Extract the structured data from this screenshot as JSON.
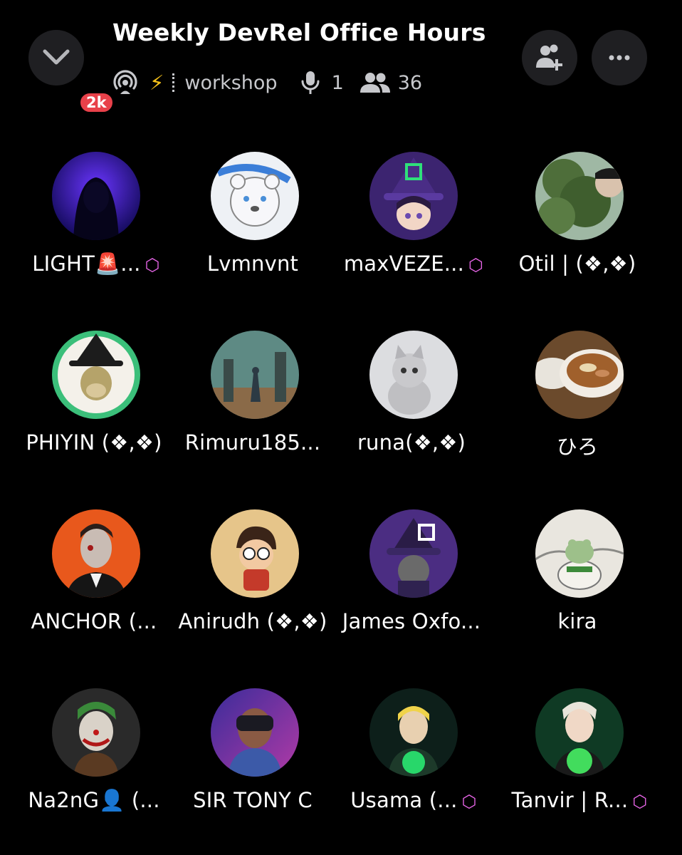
{
  "header": {
    "title": "Weekly DevRel Office Hours",
    "badge": "2k",
    "stage_icon": "stage-channel-icon",
    "emoji": "⚡",
    "channel": "workshop",
    "speakers_count": "1",
    "listeners_count": "36"
  },
  "icons": {
    "back": "chevron-down-icon",
    "invite": "add-user-icon",
    "more": "more-horizontal-icon",
    "mic": "microphone-icon",
    "group": "people-icon"
  },
  "participants": [
    {
      "name": "LIGHT🚨...",
      "boost": "⬡",
      "avatar": "hooded-figure-avatar"
    },
    {
      "name": "Lvmnvnt",
      "boost": "",
      "avatar": "bear-avatar"
    },
    {
      "name": "maxVEZE...",
      "boost": "⬡",
      "avatar": "witch-girl-avatar"
    },
    {
      "name": "Otil | (❖,❖)",
      "boost": "",
      "avatar": "tree-selfie-avatar"
    },
    {
      "name": "PHIYIN (❖,❖)",
      "boost": "",
      "avatar": "ape-wizard-avatar"
    },
    {
      "name": "Rimuru185...",
      "boost": "",
      "avatar": "ruins-avatar"
    },
    {
      "name": "runa(❖,❖)",
      "boost": "",
      "avatar": "kitten-avatar"
    },
    {
      "name": "ひろ",
      "boost": "",
      "avatar": "ramen-avatar"
    },
    {
      "name": "ANCHOR (...",
      "boost": "",
      "avatar": "man-in-tuxedo-avatar"
    },
    {
      "name": "Anirudh (❖,❖)",
      "boost": "",
      "avatar": "cartoon-boy-avatar"
    },
    {
      "name": "James Oxfo...",
      "boost": "",
      "avatar": "wizard-cat-avatar"
    },
    {
      "name": "kira",
      "boost": "",
      "avatar": "frog-avatar"
    },
    {
      "name": "Na2nG👤 (...",
      "boost": "",
      "avatar": "joker-avatar"
    },
    {
      "name": "SIR TONY C",
      "boost": "",
      "avatar": "vr-headset-avatar"
    },
    {
      "name": "Usama (...",
      "boost": "⬡",
      "avatar": "blond-character-avatar"
    },
    {
      "name": "Tanvir | R...",
      "boost": "⬡",
      "avatar": "anime-fighter-avatar"
    }
  ],
  "colors": {
    "background": "#000000",
    "button_bg": "#1f1f22",
    "badge": "#e8414a",
    "boost": "#e865e8",
    "bolt": "#f7c21a",
    "meta_text": "#c7c8cc"
  }
}
